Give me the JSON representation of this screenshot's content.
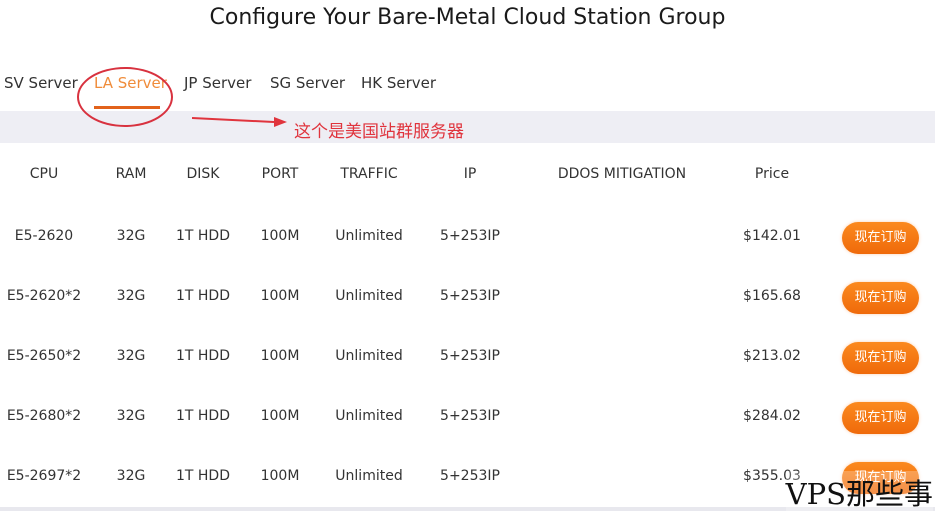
{
  "page": {
    "title": "Configure Your Bare-Metal Cloud Station Group"
  },
  "tabs": [
    {
      "label": "SV Server",
      "active": false
    },
    {
      "label": "LA Server",
      "active": true
    },
    {
      "label": "JP Server",
      "active": false
    },
    {
      "label": "SG Server",
      "active": false
    },
    {
      "label": "HK Server",
      "active": false
    }
  ],
  "annotation": {
    "text": "这个是美国站群服务器",
    "color": "#e0343d"
  },
  "table": {
    "headers": [
      "CPU",
      "RAM",
      "DISK",
      "PORT",
      "TRAFFIC",
      "IP",
      "DDOS MITIGATION",
      "Price"
    ],
    "rows": [
      {
        "cpu": "E5-2620",
        "ram": "32G",
        "disk": "1T HDD",
        "port": "100M",
        "traffic": "Unlimited",
        "ip": "5+253IP",
        "ddos": "",
        "price": "$142.01",
        "action": "现在订购"
      },
      {
        "cpu": "E5-2620*2",
        "ram": "32G",
        "disk": "1T HDD",
        "port": "100M",
        "traffic": "Unlimited",
        "ip": "5+253IP",
        "ddos": "",
        "price": "$165.68",
        "action": "现在订购"
      },
      {
        "cpu": "E5-2650*2",
        "ram": "32G",
        "disk": "1T HDD",
        "port": "100M",
        "traffic": "Unlimited",
        "ip": "5+253IP",
        "ddos": "",
        "price": "$213.02",
        "action": "现在订购"
      },
      {
        "cpu": "E5-2680*2",
        "ram": "32G",
        "disk": "1T HDD",
        "port": "100M",
        "traffic": "Unlimited",
        "ip": "5+253IP",
        "ddos": "",
        "price": "$284.02",
        "action": "现在订购"
      },
      {
        "cpu": "E5-2697*2",
        "ram": "32G",
        "disk": "1T HDD",
        "port": "100M",
        "traffic": "Unlimited",
        "ip": "5+253IP",
        "ddos": "",
        "price": "$355.03",
        "action": "现在订购"
      }
    ]
  },
  "colors": {
    "accent": "#f08c3a",
    "underline": "#e2621b",
    "button": "#f57a14"
  },
  "watermark": "VPS那些事"
}
